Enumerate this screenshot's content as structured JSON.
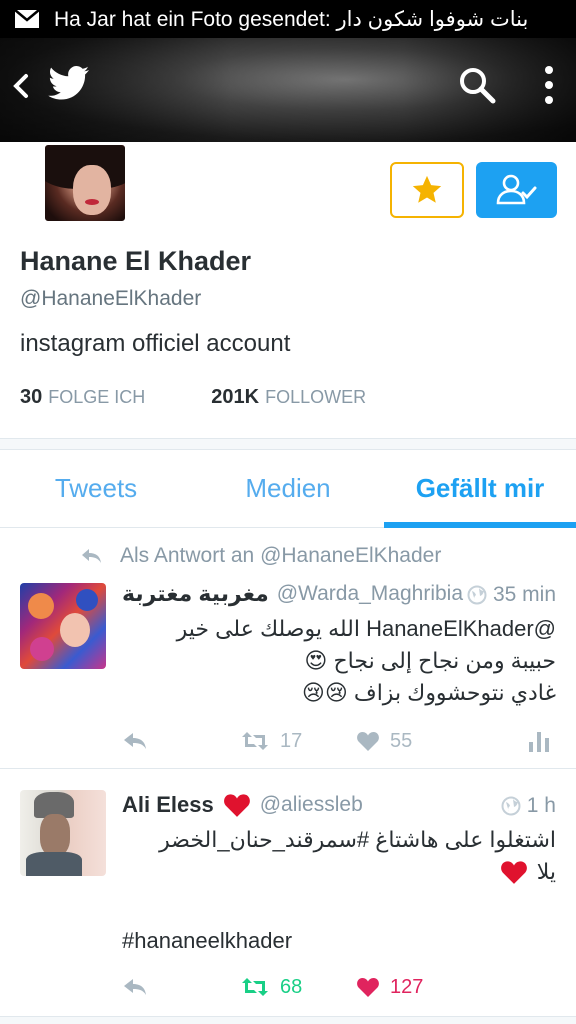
{
  "status_bar": {
    "notification": "Ha Jar hat ein Foto gesendet: بنات شوفوا شكون دار"
  },
  "header": {
    "icons": [
      "back-icon",
      "twitter-bird-icon",
      "search-icon",
      "more-vert-icon"
    ]
  },
  "profile": {
    "name": "Hanane El Khader",
    "handle": "@HananeElKhader",
    "bio": "instagram officiel account",
    "following_count": "30",
    "following_label": "FOLGE ICH",
    "followers_count": "201K",
    "followers_label": "FOLLOWER"
  },
  "tabs": [
    {
      "label": "Tweets",
      "active": false
    },
    {
      "label": "Medien",
      "active": false
    },
    {
      "label": "Gefällt mir",
      "active": true
    }
  ],
  "tweets": [
    {
      "reply_context": "Als Antwort an @HananeElKhader",
      "name": "مغربية مغتربة",
      "handle": "@Warda_Maghribia",
      "time": "35 min",
      "lines": [
        "@HananeElKhader  الله يوصلك على خير",
        "حبيبة ومن نجاح إلى نجاح 😍",
        "غادي نتوحشووك  بزاف 😢😢"
      ],
      "retweets": "17",
      "likes": "55"
    },
    {
      "name": "Ali Eless",
      "handle": "@aliessleb",
      "time": "1 h",
      "lines": [
        "اشتغلوا على هاشتاغ #سمرقند_حنان_الخضر",
        "يلا"
      ],
      "hashtag": "#hananeelkhader",
      "retweets": "68",
      "likes": "127"
    }
  ],
  "colors": {
    "accent": "#1da1f2",
    "star": "#f5b301",
    "retweet_active": "#19cf86",
    "like_active": "#e0245e",
    "muted": "#8899a6"
  }
}
